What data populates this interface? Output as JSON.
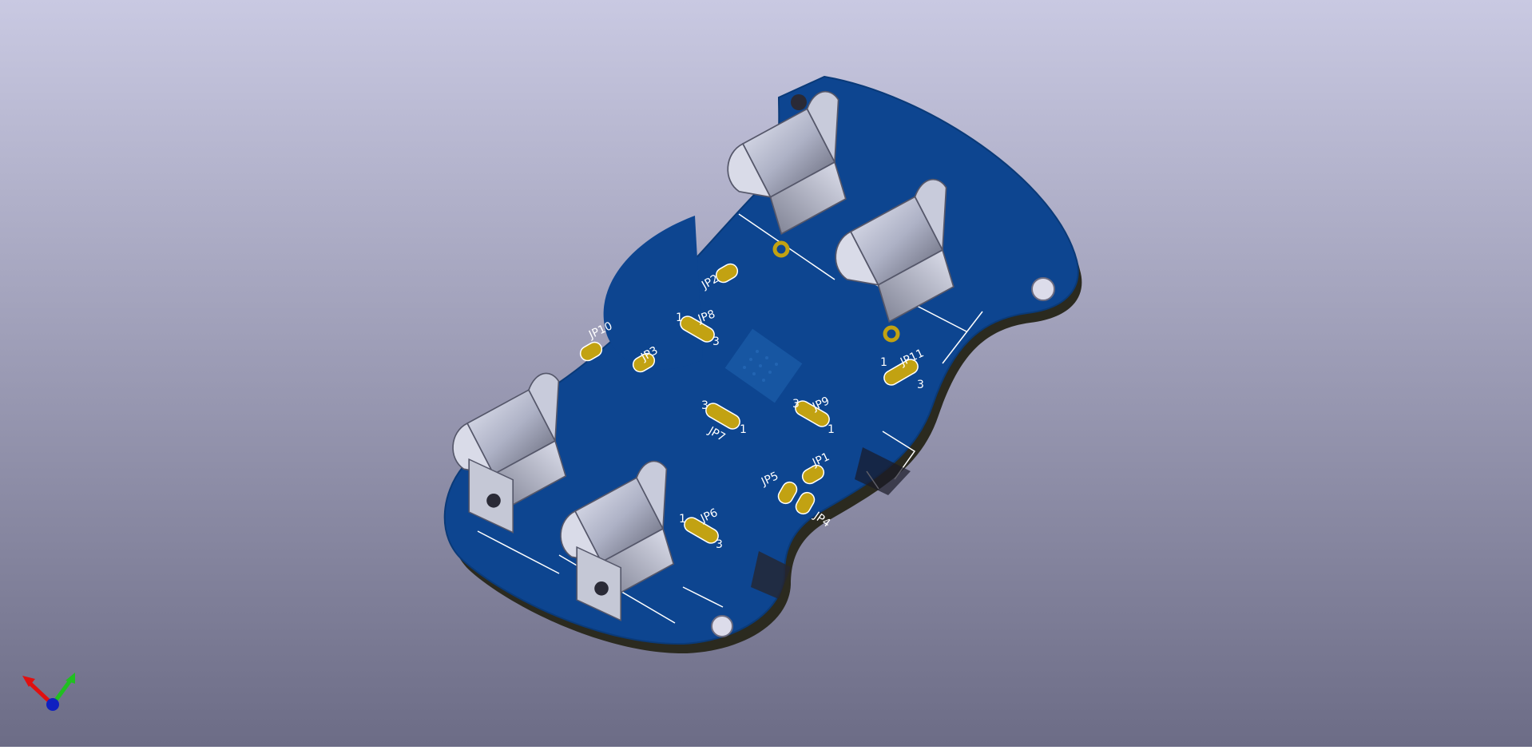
{
  "viewer": {
    "background_top": "#c9c9e2",
    "background_bottom": "#6c6c86",
    "board_color": "#0d4590",
    "board_edge_color": "#2b2a1f",
    "pad_color": "#c2a212",
    "silkscreen_color": "#ffffff",
    "clip_metal_color": "#b9bccd"
  },
  "board": {
    "labels": {
      "jp1": "JP1",
      "jp2": "JP2",
      "jp3": "JP3",
      "jp4": "JP4",
      "jp5": "JP5",
      "jp6": "JP6",
      "jp7": "JP7",
      "jp8": "JP8",
      "jp9": "JP9",
      "jp10": "JP10",
      "jp11": "JP11"
    },
    "pin_numbers": {
      "jp6_1": "1",
      "jp6_3": "3",
      "jp7_3": "3",
      "jp7_1": "1",
      "jp8_1": "1",
      "jp8_3": "3",
      "jp9_3": "3",
      "jp9_1": "1",
      "jp11_1": "1",
      "jp11_3": "3"
    }
  },
  "axes_gizmo": {
    "x_color": "#e01010",
    "y_color": "#20c020",
    "z_color": "#1020c0"
  }
}
